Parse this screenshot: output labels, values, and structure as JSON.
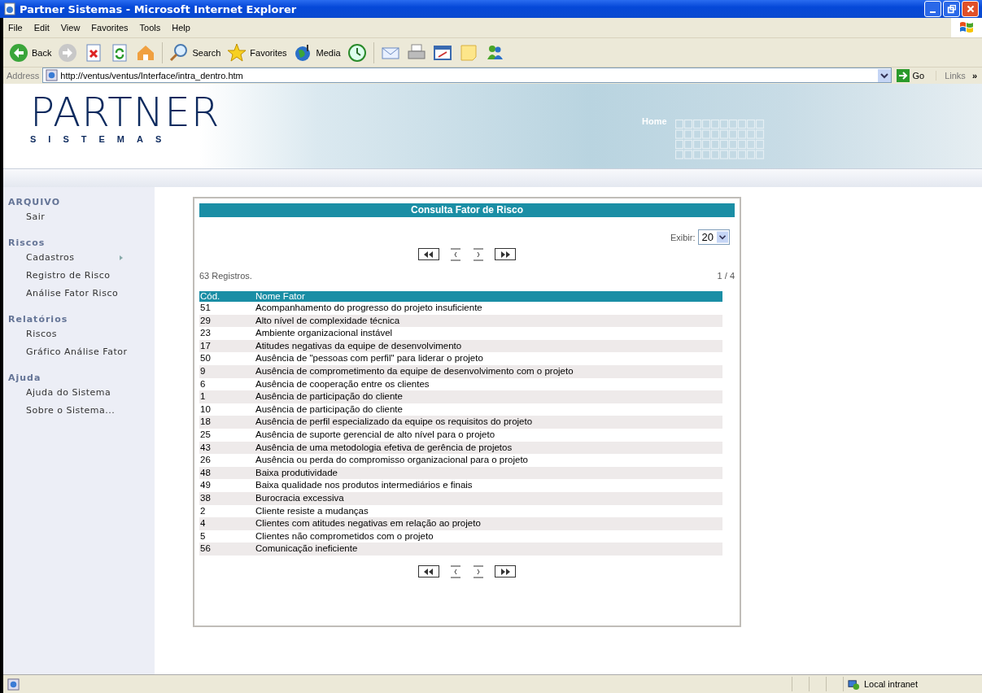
{
  "window": {
    "title": "Partner Sistemas - Microsoft Internet Explorer"
  },
  "menu": [
    "File",
    "Edit",
    "View",
    "Favorites",
    "Tools",
    "Help"
  ],
  "toolbar": [
    {
      "kind": "back",
      "label": "Back"
    },
    {
      "kind": "forward"
    },
    {
      "kind": "stop"
    },
    {
      "kind": "refresh"
    },
    {
      "kind": "home"
    },
    {
      "kind": "search",
      "label": "Search"
    },
    {
      "kind": "favorites",
      "label": "Favorites"
    },
    {
      "kind": "media",
      "label": "Media"
    },
    {
      "kind": "history"
    },
    {
      "kind": "mail"
    },
    {
      "kind": "print"
    },
    {
      "kind": "edit"
    },
    {
      "kind": "note"
    },
    {
      "kind": "messenger"
    }
  ],
  "address": {
    "label": "Address",
    "value": "http://ventus/ventus/Interface/intra_dentro.htm",
    "go": "Go",
    "links": "Links",
    "more": "»"
  },
  "header": {
    "logo_main": "PARTNER",
    "logo_sub": "SISTEMAS",
    "home_link": "Home"
  },
  "sidebar": {
    "sections": [
      {
        "title": "ARQUIVO",
        "items": [
          {
            "label": "Sair",
            "has_submenu": false
          }
        ]
      },
      {
        "title": "Riscos",
        "items": [
          {
            "label": "Cadastros",
            "has_submenu": true
          },
          {
            "label": "Registro de Risco",
            "has_submenu": false
          },
          {
            "label": "Análise Fator Risco",
            "has_submenu": false
          }
        ]
      },
      {
        "title": "Relatórios",
        "items": [
          {
            "label": "Riscos",
            "has_submenu": false
          },
          {
            "label": "Gráfico Análise Fator",
            "has_submenu": false
          }
        ]
      },
      {
        "title": "Ajuda",
        "items": [
          {
            "label": "Ajuda do Sistema",
            "has_submenu": false
          },
          {
            "label": "Sobre o Sistema...",
            "has_submenu": false
          }
        ]
      }
    ]
  },
  "panel": {
    "title": "Consulta Fator de Risco",
    "exibir_label": "Exibir:",
    "page_size": "20",
    "records": "63 Registros.",
    "page": "1 / 4",
    "columns": [
      "Cód.",
      "Nome Fator"
    ],
    "rows": [
      {
        "code": "51",
        "name": "Acompanhamento do progresso do projeto insuficiente"
      },
      {
        "code": "29",
        "name": "Alto nível de complexidade técnica"
      },
      {
        "code": "23",
        "name": "Ambiente organizacional instável"
      },
      {
        "code": "17",
        "name": "Atitudes negativas da equipe de desenvolvimento"
      },
      {
        "code": "50",
        "name": "Ausência de \"pessoas com perfil\" para liderar o projeto"
      },
      {
        "code": "9",
        "name": "Ausência de comprometimento da equipe de desenvolvimento com o projeto"
      },
      {
        "code": "6",
        "name": "Ausência de cooperação entre os clientes"
      },
      {
        "code": "1",
        "name": "Ausência de participação do cliente"
      },
      {
        "code": "10",
        "name": "Ausência de participação do cliente"
      },
      {
        "code": "18",
        "name": "Ausência de perfil especializado da equipe os requisitos do projeto"
      },
      {
        "code": "25",
        "name": "Ausência de suporte gerencial de alto nível para o projeto"
      },
      {
        "code": "43",
        "name": "Ausência de uma metodologia efetiva de gerência de projetos"
      },
      {
        "code": "26",
        "name": "Ausência ou perda do compromisso organizacional para o projeto"
      },
      {
        "code": "48",
        "name": "Baixa produtividade"
      },
      {
        "code": "49",
        "name": "Baixa qualidade nos produtos intermediários e finais"
      },
      {
        "code": "38",
        "name": "Burocracia excessiva"
      },
      {
        "code": "2",
        "name": "Cliente resiste a mudanças"
      },
      {
        "code": "4",
        "name": "Clientes com atitudes negativas em relação ao projeto"
      },
      {
        "code": "5",
        "name": "Clientes não comprometidos com o projeto"
      },
      {
        "code": "56",
        "name": "Comunicação ineficiente"
      }
    ]
  },
  "status_bar": {
    "zone": "Local intranet"
  }
}
